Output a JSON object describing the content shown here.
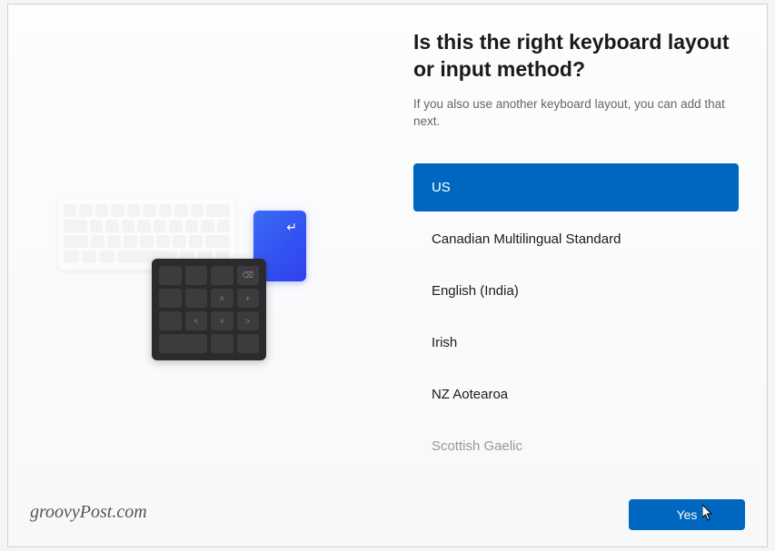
{
  "heading": "Is this the right keyboard layout or input method?",
  "subtext": "If you also use another keyboard layout, you can add that next.",
  "layouts": [
    {
      "label": "US",
      "selected": true
    },
    {
      "label": "Canadian Multilingual Standard",
      "selected": false
    },
    {
      "label": "English (India)",
      "selected": false
    },
    {
      "label": "Irish",
      "selected": false
    },
    {
      "label": "NZ Aotearoa",
      "selected": false
    },
    {
      "label": "Scottish Gaelic",
      "selected": false
    }
  ],
  "confirm_button": "Yes",
  "watermark": "groovyPost.com",
  "colors": {
    "accent": "#0067c0"
  }
}
